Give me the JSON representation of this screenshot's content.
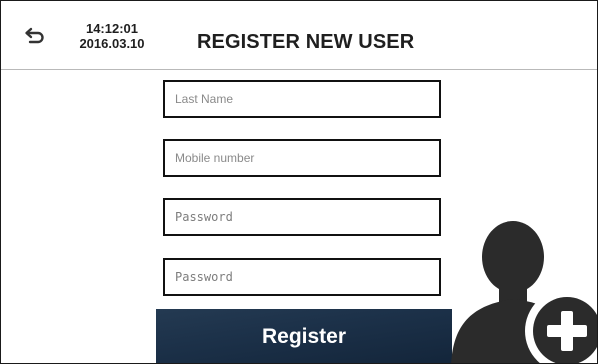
{
  "header": {
    "time": "14:12:01",
    "date": "2016.03.10",
    "title": "REGISTER NEW USER"
  },
  "form": {
    "last_name_placeholder": "Last Name",
    "mobile_placeholder": "Mobile number",
    "password_placeholder": "Password",
    "confirm_password_placeholder": "Password"
  },
  "register_label": "Register",
  "icons": {
    "back": "back-arrow-icon",
    "add_user": "add-user-icon"
  },
  "colors": {
    "button_bg": "#1c3149",
    "icon_dark": "#2b2b2b"
  }
}
